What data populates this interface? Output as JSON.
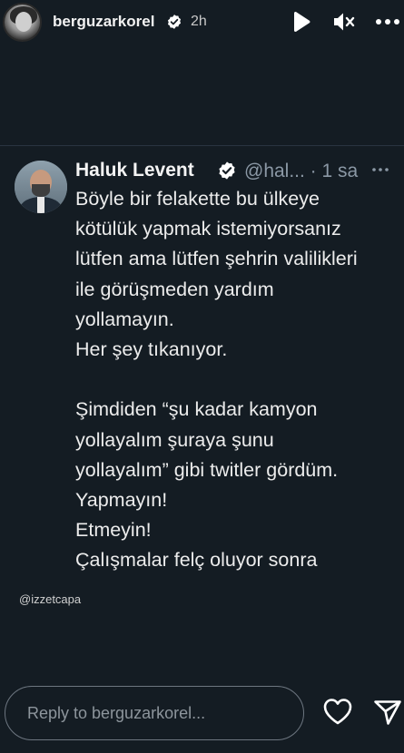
{
  "header": {
    "username": "berguzarkorel",
    "time": "2h",
    "icons": {
      "play": "play-icon",
      "mute": "speaker-muted-icon",
      "more": "more-horizontal-icon",
      "verified": "verified-badge-icon"
    }
  },
  "tweet": {
    "name": "Haluk Levent",
    "handle": "@hal... · 1 sa",
    "lines": [
      "Böyle bir felakette bu ülkeye",
      "kötülük yapmak istemiyorsanız",
      "lütfen ama lütfen şehrin valilikleri",
      "ile görüşmeden yardım",
      "yollamayın.",
      "Her şey tıkanıyor.",
      "",
      "Şimdiden “şu kadar kamyon",
      "yollayalım şuraya şunu",
      "yollayalım” gibi twitler gördüm.",
      "Yapmayın!",
      "Etmeyin!",
      "Çalışmalar felç oluyor sonra"
    ]
  },
  "credit": "@izzetcapa",
  "footer": {
    "reply_placeholder": "Reply to berguzarkorel...",
    "icons": {
      "like": "heart-icon",
      "send": "send-icon"
    }
  },
  "colors": {
    "background": "#141c23",
    "verified": "#ffffff",
    "handle": "#8b98a5"
  }
}
